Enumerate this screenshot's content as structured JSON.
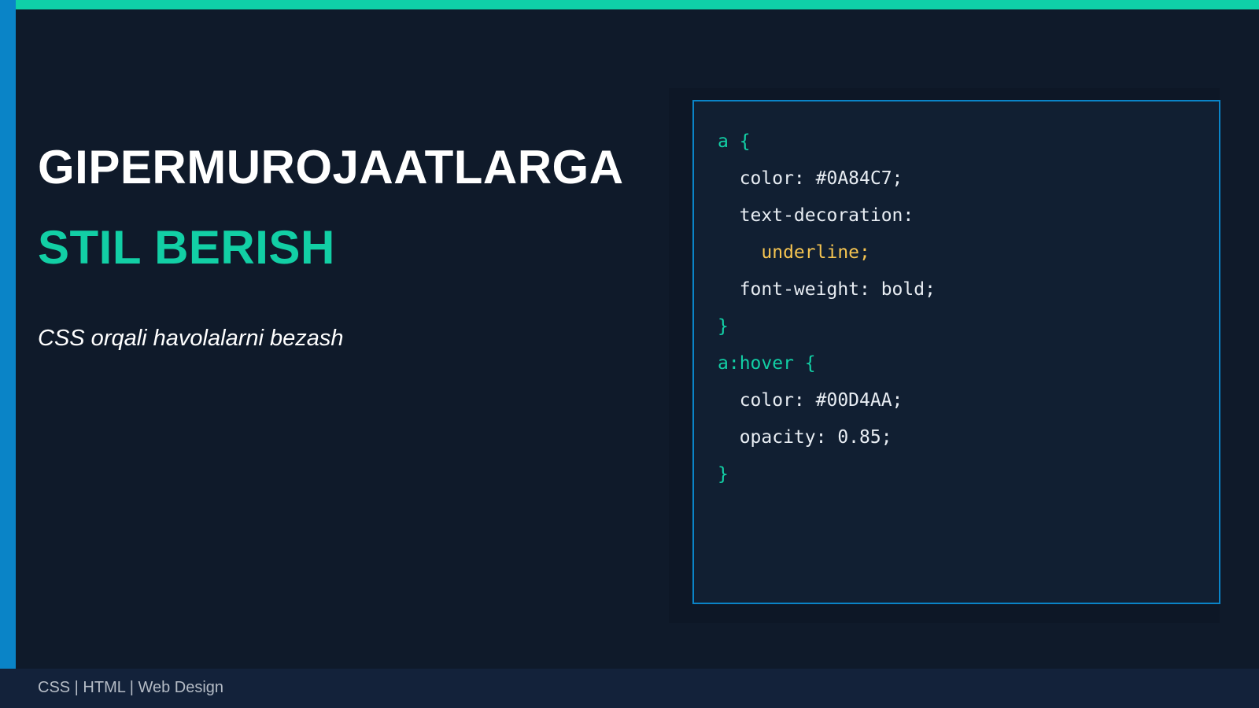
{
  "slide": {
    "title_line1": "GIPERMUROJAATLARGA",
    "title_line2": "STIL BERISH",
    "subtitle": "CSS orqali havolalarni bezash"
  },
  "code": {
    "lines": [
      "a {",
      "  color: #0A84C7;",
      "  text-decoration:",
      "    underline;",
      "  font-weight: bold;",
      "}",
      "a:hover {",
      "  color: #00D4AA;",
      "  opacity: 0.85;",
      "}"
    ]
  },
  "footer": {
    "text": "CSS | HTML | Web Design"
  },
  "colors": {
    "accent_teal": "#0fd0a8",
    "accent_blue": "#0a84c7",
    "background": "#0f1a2a",
    "code_keyword": "#12cfa5",
    "code_value_highlight": "#f5c451"
  }
}
